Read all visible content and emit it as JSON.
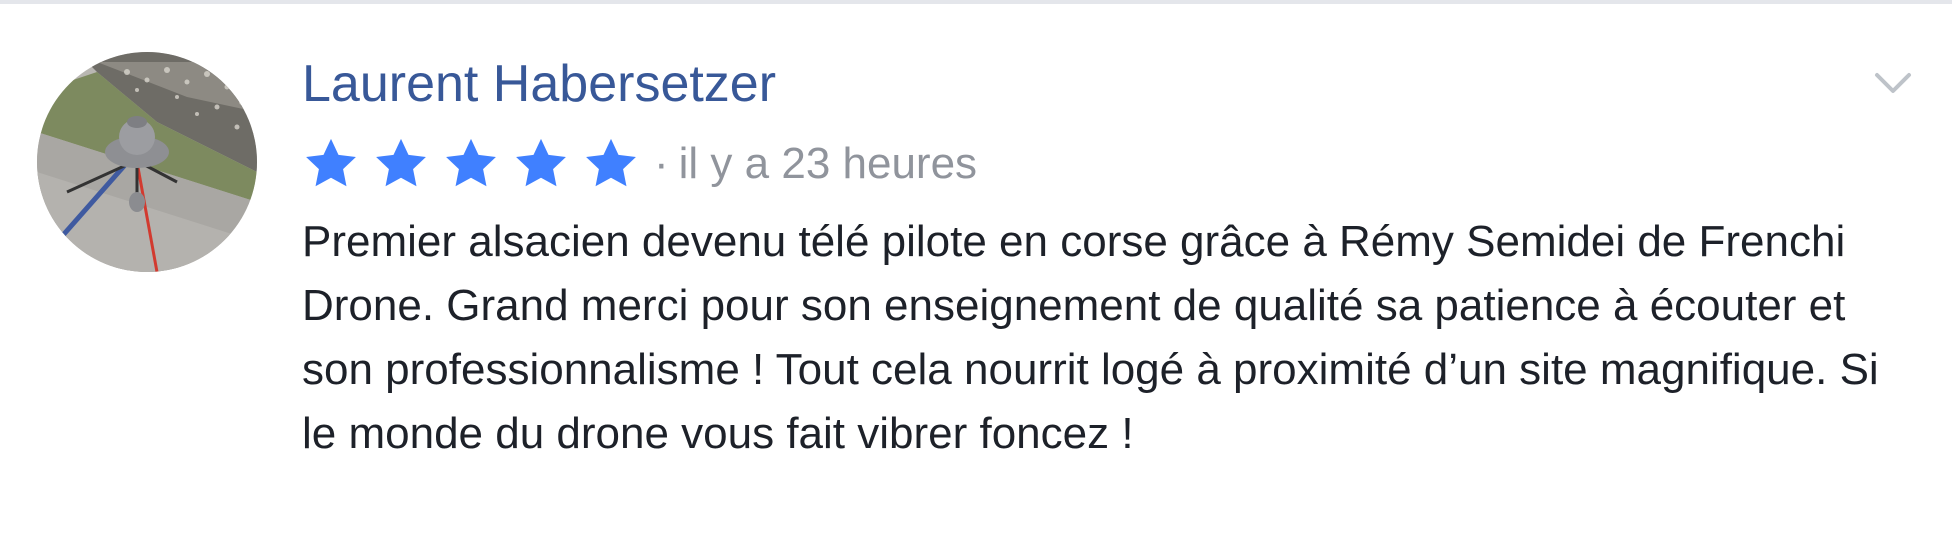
{
  "review": {
    "author_name": "Laurent Habersetzer",
    "rating": 5,
    "rating_max": 5,
    "separator": "·",
    "time_ago": "il y a 23 heures",
    "text": "Premier alsacien devenu télé pilote en corse grâce à Rémy Semidei de Frenchi Drone. Grand merci pour son enseignement de qualité sa patience à écouter et son professionnalisme ! Tout cela nourrit logé à proximité d’un site magnifique. Si le monde du drone vous fait vibrer foncez !",
    "avatar_icon": "drone-photo",
    "options_icon": "chevron-down-icon"
  },
  "colors": {
    "author_link": "#385898",
    "star": "#4080ff",
    "meta_text": "#90949c",
    "body_text": "#1d2129",
    "divider": "#e4e6eb",
    "chevron": "#bec3c9"
  }
}
